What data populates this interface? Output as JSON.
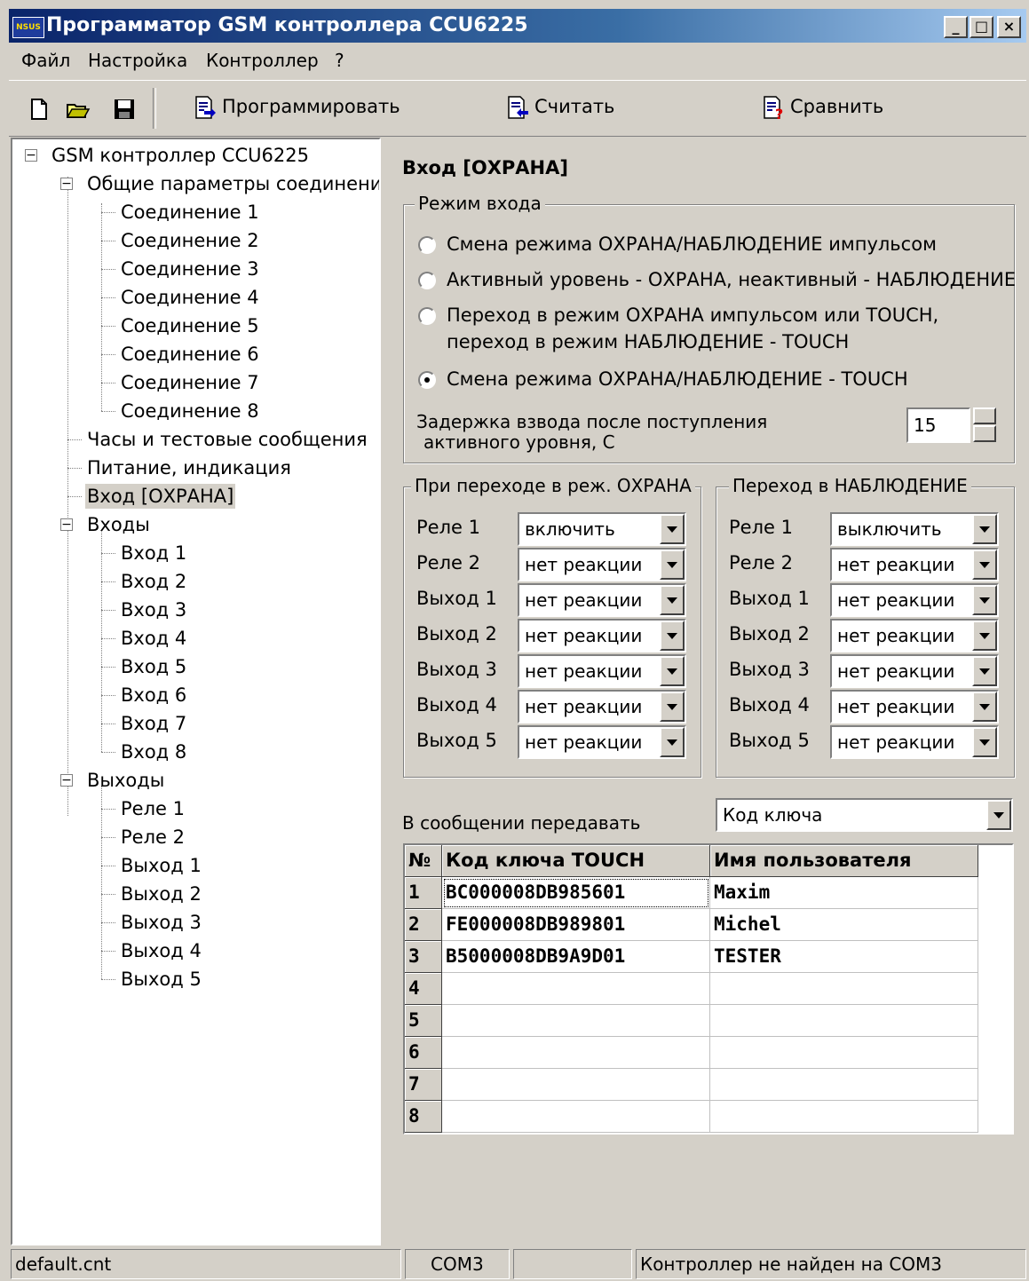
{
  "window": {
    "title": "Программатор GSM контроллера CCU6225",
    "icon_text": "NSUS"
  },
  "menu": [
    "Файл",
    "Настройка",
    "Контроллер",
    "?"
  ],
  "toolbar": {
    "program_label": "Программировать",
    "read_label": "Считать",
    "compare_label": "Сравнить"
  },
  "tree": {
    "root": "GSM контроллер CCU6225",
    "general": "Общие параметры соединений",
    "connections": [
      "Соединение 1",
      "Соединение 2",
      "Соединение 3",
      "Соединение 4",
      "Соединение 5",
      "Соединение 6",
      "Соединение 7",
      "Соединение 8"
    ],
    "clock": "Часы и тестовые сообщения",
    "power": "Питание, индикация",
    "security_input": "Вход [ОХРАНА]",
    "inputs": "Входы",
    "input_items": [
      "Вход 1",
      "Вход 2",
      "Вход 3",
      "Вход 4",
      "Вход 5",
      "Вход 6",
      "Вход 7",
      "Вход 8"
    ],
    "outputs": "Выходы",
    "output_items": [
      "Реле 1",
      "Реле 2",
      "Выход 1",
      "Выход 2",
      "Выход 3",
      "Выход 4",
      "Выход 5"
    ]
  },
  "panel": {
    "title": "Вход [ОХРАНА]",
    "mode_group": "Режим входа",
    "modes": [
      "Смена режима ОХРАНА/НАБЛЮДЕНИЕ импульсом",
      "Активный уровень - ОХРАНА, неактивный - НАБЛЮДЕНИЕ",
      "Переход в режим ОХРАНА импульсом или TOUCH,",
      "Смена режима ОХРАНА/НАБЛЮДЕНИЕ - TOUCH"
    ],
    "mode3_line2": "переход в режим НАБЛЮДЕНИЕ - TOUCH",
    "selected_mode": 3,
    "delay_label_1": "Задержка взвода после поступления",
    "delay_label_2": "активного уровня, С",
    "delay_value": "15",
    "arm_group": "При переходе в реж. ОХРАНА",
    "watch_group": "Переход в НАБЛЮДЕНИЕ",
    "rows": [
      "Реле 1",
      "Реле 2",
      "Выход 1",
      "Выход 2",
      "Выход 3",
      "Выход 4",
      "Выход 5"
    ],
    "arm_values": [
      "включить",
      "нет реакции",
      "нет реакции",
      "нет реакции",
      "нет реакции",
      "нет реакции",
      "нет реакции"
    ],
    "watch_values": [
      "выключить",
      "нет реакции",
      "нет реакции",
      "нет реакции",
      "нет реакции",
      "нет реакции",
      "нет реакции"
    ],
    "message_label": "В сообщении передавать",
    "message_value": "Код ключа"
  },
  "grid": {
    "headers": [
      "№",
      "Код ключа TOUCH",
      "Имя пользователя"
    ],
    "rows": [
      {
        "n": "1",
        "key": "BC000008DB985601",
        "name": "Maxim"
      },
      {
        "n": "2",
        "key": "FE000008DB989801",
        "name": "Michel"
      },
      {
        "n": "3",
        "key": "B5000008DB9A9D01",
        "name": "TESTER"
      },
      {
        "n": "4",
        "key": "",
        "name": ""
      },
      {
        "n": "5",
        "key": "",
        "name": ""
      },
      {
        "n": "6",
        "key": "",
        "name": ""
      },
      {
        "n": "7",
        "key": "",
        "name": ""
      },
      {
        "n": "8",
        "key": "",
        "name": ""
      }
    ]
  },
  "status": {
    "file": "default.cnt",
    "port": "COM3",
    "blank": "",
    "message": "Контроллер не найден на COM3"
  }
}
